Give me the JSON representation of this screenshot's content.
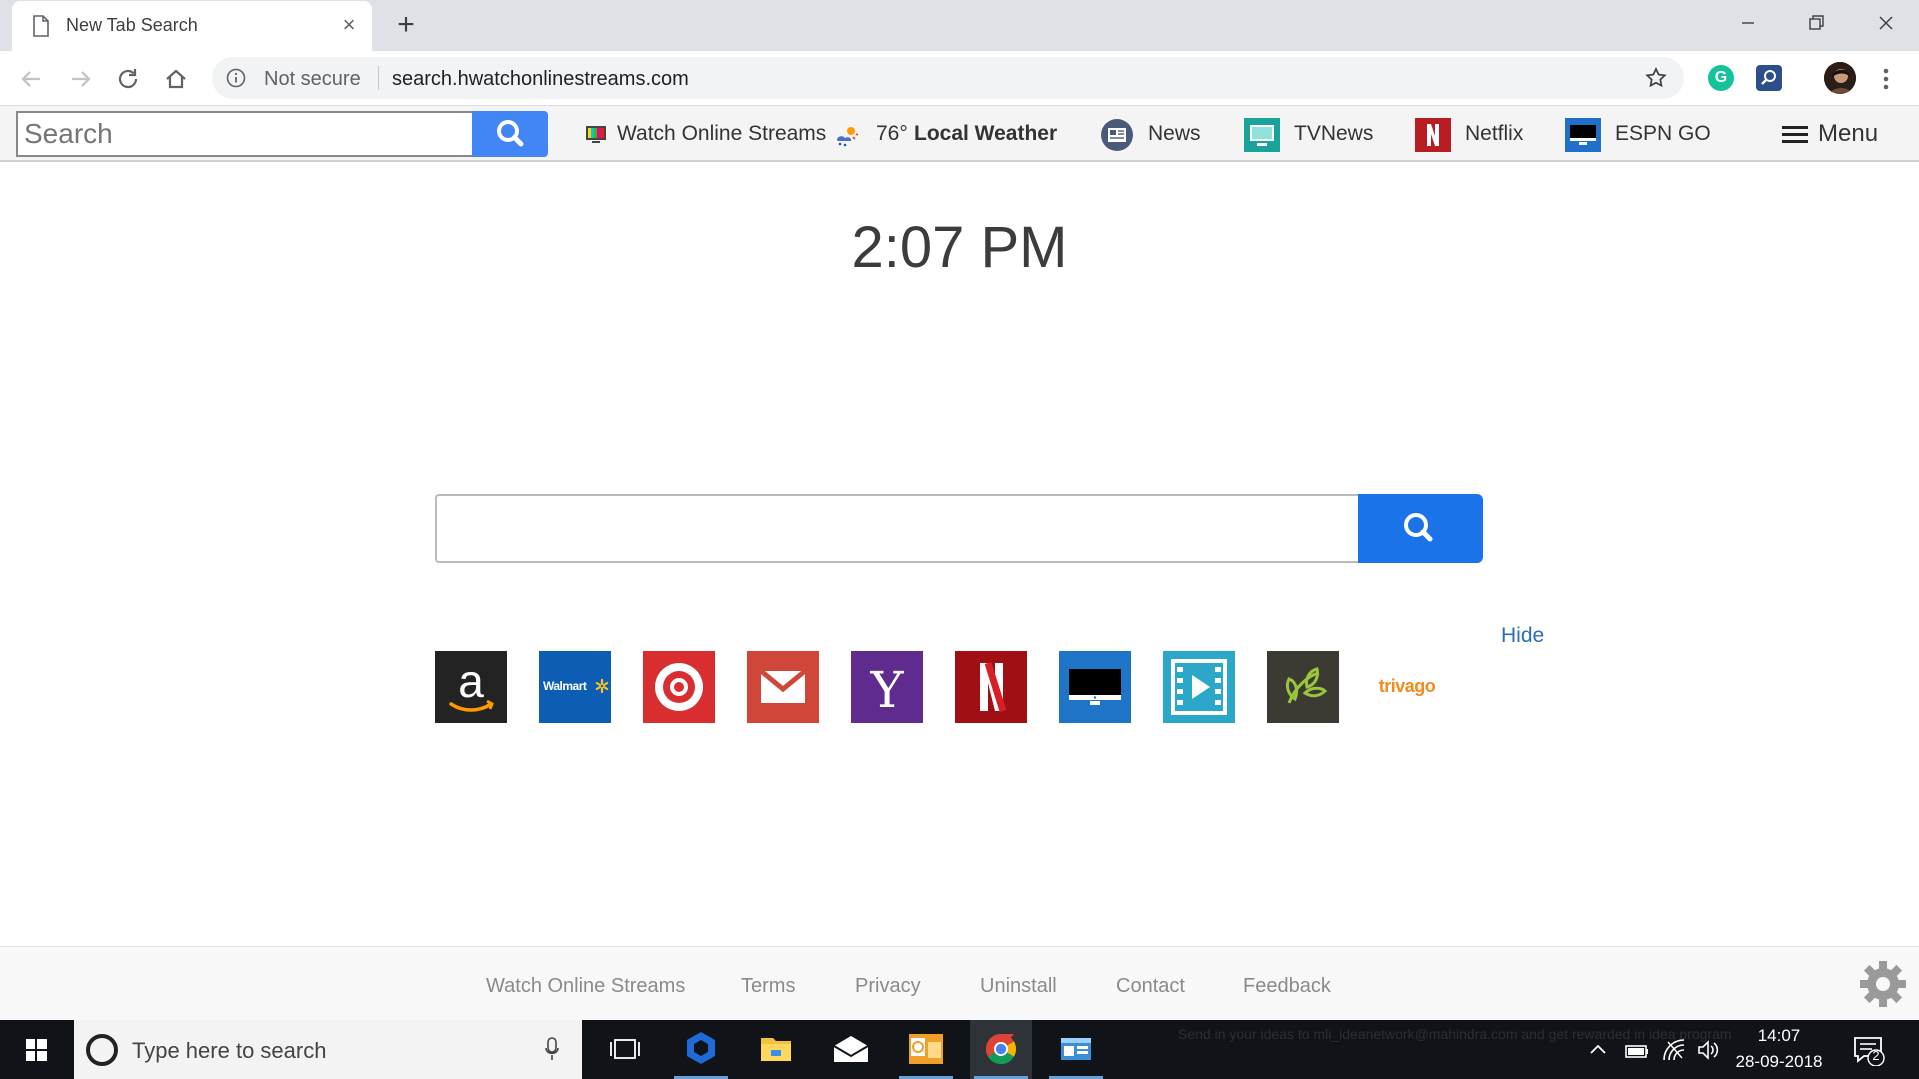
{
  "browser": {
    "tab_title": "New Tab Search",
    "new_tab": "+",
    "not_secure": "Not secure",
    "url": "search.hwatchonlinestreams.com",
    "grammarly_letter": "G"
  },
  "extbar": {
    "search_placeholder": "Search",
    "links": {
      "watch": "Watch Online Streams",
      "temp": "76°",
      "weather": "Local Weather",
      "news": "News",
      "tvnews": "TVNews",
      "netflix": "Netflix",
      "espn": "ESPN GO"
    },
    "menu": "Menu"
  },
  "main": {
    "clock": "2:07 PM",
    "hide": "Hide",
    "tiles": {
      "walmart": "Walmart",
      "yahoo": "Y",
      "netflix": "N",
      "trivago": "trivago"
    }
  },
  "footer": {
    "links": {
      "watch": "Watch Online Streams",
      "terms": "Terms",
      "privacy": "Privacy",
      "uninstall": "Uninstall",
      "contact": "Contact",
      "feedback": "Feedback"
    }
  },
  "taskbar": {
    "search_placeholder": "Type here to search",
    "watermark": "Send in your ideas to mli_ideanetwork@mahindra.com and get rewarded in idea program",
    "time": "14:07",
    "date": "28-09-2018",
    "notification_count": "2"
  },
  "colors": {
    "accent_blue": "#1a73e8",
    "ext_search_blue": "#4285f4",
    "hide_link": "#2a6db5",
    "taskbar": "#101418"
  }
}
